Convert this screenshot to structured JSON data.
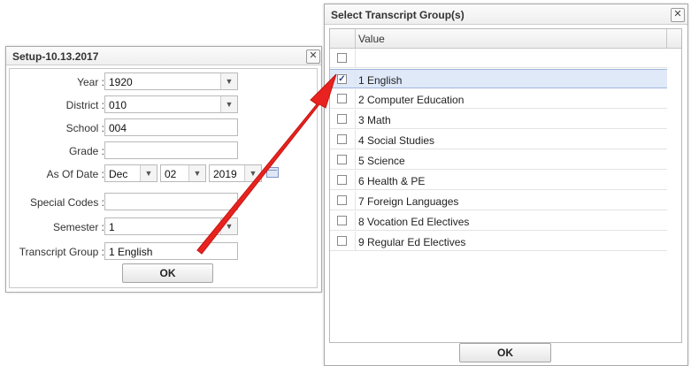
{
  "setup": {
    "title": "Setup-10.13.2017",
    "close_glyph": "✕",
    "fields": {
      "year": {
        "label": "Year :",
        "value": "1920"
      },
      "district": {
        "label": "District :",
        "value": "010"
      },
      "school": {
        "label": "School :",
        "value": "004"
      },
      "grade": {
        "label": "Grade :",
        "value": ""
      },
      "as_of_date": {
        "label": "As Of Date :",
        "month": "Dec",
        "day": "02",
        "year": "2019"
      },
      "special_codes": {
        "label": "Special Codes :",
        "value": ""
      },
      "semester": {
        "label": "Semester :",
        "value": "1"
      },
      "transcript_group": {
        "label": "Transcript Group :",
        "value": "1 English"
      }
    },
    "ok_label": "OK"
  },
  "transcript_dialog": {
    "title": "Select Transcript Group(s)",
    "close_glyph": "✕",
    "column_header": "Value",
    "rows": [
      {
        "label": "",
        "checked": false
      },
      {
        "label": "1 English",
        "checked": true
      },
      {
        "label": "2 Computer Education",
        "checked": false
      },
      {
        "label": "3 Math",
        "checked": false
      },
      {
        "label": "4 Social Studies",
        "checked": false
      },
      {
        "label": "5 Science",
        "checked": false
      },
      {
        "label": "6 Health & PE",
        "checked": false
      },
      {
        "label": "7 Foreign Languages",
        "checked": false
      },
      {
        "label": "8 Vocation Ed Electives",
        "checked": false
      },
      {
        "label": "9 Regular Ed Electives",
        "checked": false
      }
    ],
    "ok_label": "OK"
  },
  "icons": {
    "dropdown": "chevron-down-icon",
    "calendar": "calendar-icon",
    "check": "✓"
  },
  "colors": {
    "selected_row": "#dfe9f8",
    "annotation_arrow": "#e8231f"
  }
}
